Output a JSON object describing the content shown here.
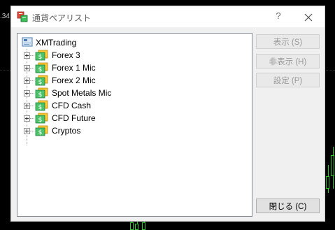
{
  "background": {
    "edge_text": ".34"
  },
  "dialog": {
    "title": "通貨ペアリスト",
    "help_label": "?",
    "close_icon": "close-icon"
  },
  "tree": {
    "root": {
      "label": "XMTrading",
      "icon": "server-icon"
    },
    "items": [
      {
        "label": "Forex 3"
      },
      {
        "label": "Forex 1 Mic"
      },
      {
        "label": "Forex 2 Mic"
      },
      {
        "label": "Spot Metals Mic"
      },
      {
        "label": "CFD Cash"
      },
      {
        "label": "CFD Future"
      },
      {
        "label": "Cryptos"
      }
    ]
  },
  "buttons": {
    "show": "表示 (S)",
    "hide": "非表示 (H)",
    "properties": "設定 (P)",
    "close": "閉じる (C)"
  },
  "colors": {
    "chart_background": "#000000",
    "candle_green": "#2fd32f",
    "dialog_background": "#f0f0f0",
    "disabled_text": "#9a9a9a"
  }
}
